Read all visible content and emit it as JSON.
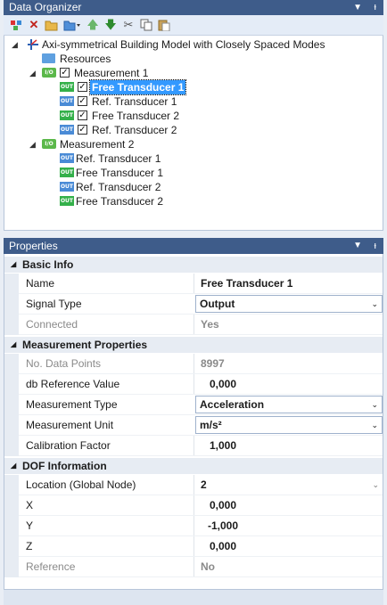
{
  "data_organizer": {
    "title": "Data Organizer",
    "pin_icon": "pin-icon",
    "dropdown_icon": "chevron-down-icon",
    "toolbar": [
      {
        "name": "new-item-button",
        "icon": "new-item-icon"
      },
      {
        "name": "delete-button",
        "icon": "delete-icon"
      },
      {
        "name": "open-folder-button",
        "icon": "open-folder-icon"
      },
      {
        "name": "import-button",
        "icon": "import-icon"
      },
      {
        "name": "move-up-button",
        "icon": "arrow-up-icon"
      },
      {
        "name": "move-down-button",
        "icon": "arrow-down-icon"
      },
      {
        "name": "cut-button",
        "icon": "cut-icon"
      },
      {
        "name": "copy-button",
        "icon": "copy-icon"
      },
      {
        "name": "paste-button",
        "icon": "paste-icon"
      }
    ],
    "tree": {
      "root": "Axi-symmetrical Building Model with Closely Spaced Modes",
      "resources": "Resources",
      "measurement1": {
        "label": "Measurement 1",
        "checked": true,
        "items": [
          {
            "label": "Free Transducer 1",
            "type": "OUT",
            "checked": true,
            "selected": true
          },
          {
            "label": "Ref. Transducer 1",
            "type": "OUT",
            "checked": true
          },
          {
            "label": "Free Transducer 2",
            "type": "OUT",
            "checked": true
          },
          {
            "label": "Ref. Transducer 2",
            "type": "OUT",
            "checked": true
          }
        ]
      },
      "measurement2": {
        "label": "Measurement 2",
        "items": [
          {
            "label": "Ref. Transducer 1",
            "type": "OUT"
          },
          {
            "label": "Free Transducer 1",
            "type": "OUT"
          },
          {
            "label": "Ref. Transducer 2",
            "type": "OUT"
          },
          {
            "label": "Free Transducer 2",
            "type": "OUT"
          }
        ]
      },
      "io_tag": "I/O",
      "out_tag": "OUT"
    }
  },
  "properties": {
    "title": "Properties",
    "basic_info": {
      "header": "Basic Info",
      "name_label": "Name",
      "name_value": "Free Transducer 1",
      "signal_type_label": "Signal Type",
      "signal_type_value": "Output",
      "connected_label": "Connected",
      "connected_value": "Yes"
    },
    "measurement_properties": {
      "header": "Measurement Properties",
      "points_label": "No. Data Points",
      "points_value": "8997",
      "db_ref_label": "db Reference Value",
      "db_ref_value": "0,000",
      "mtype_label": "Measurement Type",
      "mtype_value": "Acceleration",
      "munit_label": "Measurement Unit",
      "munit_value": "m/s²",
      "calib_label": "Calibration Factor",
      "calib_value": "1,000"
    },
    "dof_information": {
      "header": "DOF Information",
      "location_label": "Location (Global Node)",
      "location_value": "2",
      "x_label": "X",
      "x_value": "0,000",
      "y_label": "Y",
      "y_value": "-1,000",
      "z_label": "Z",
      "z_value": "0,000",
      "reference_label": "Reference",
      "reference_value": "No"
    }
  }
}
